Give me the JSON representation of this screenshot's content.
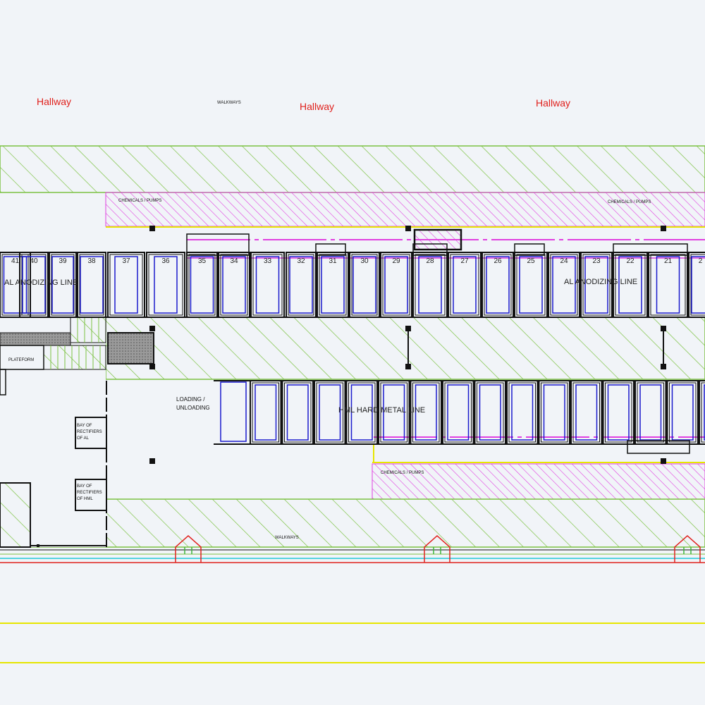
{
  "labels": {
    "hallway_left": "Hallway",
    "hallway_center": "Hallway",
    "hallway_right": "Hallway",
    "walkways_top": "WALKWAYS",
    "walkways_bottom": "WALKWAYS",
    "chem_pumps_top_left": "CHEMICALS / PUMPS",
    "chem_pumps_top_right": "CHEMICALS / PUMPS",
    "chem_pumps_bottom": "CHEMICALS / PUMPS",
    "al_line_left": "AL ANODIZING LINE",
    "al_line_right": "AL ANODIZING LINE",
    "hml_line": "HML HARD METAL LINE",
    "loading_1": "LOADING /",
    "loading_2": "UNLOADING",
    "platform": "PLATEFORM",
    "bay_al_1": "BAY OF",
    "bay_al_2": "RECTIFIERS",
    "bay_al_3": "OF AL",
    "bay_hml_1": "BAY OF",
    "bay_hml_2": "RECTIFIERS",
    "bay_hml_3": "OF HML"
  },
  "tanks_top": [
    "41",
    "40",
    "39",
    "38",
    "37",
    "36",
    "35",
    "34",
    "33",
    "32",
    "31",
    "30",
    "29",
    "28",
    "27",
    "26",
    "25",
    "24",
    "23",
    "22",
    "21",
    "2"
  ],
  "colors": {
    "hatch_green": "#7cc242",
    "hatch_magenta": "#e040e0",
    "hallway_red": "#e0201c",
    "tank_blue": "#1a1acc",
    "yellow_line": "#e6e600",
    "cyan_line": "#22c8d8",
    "outline": "#111111"
  }
}
